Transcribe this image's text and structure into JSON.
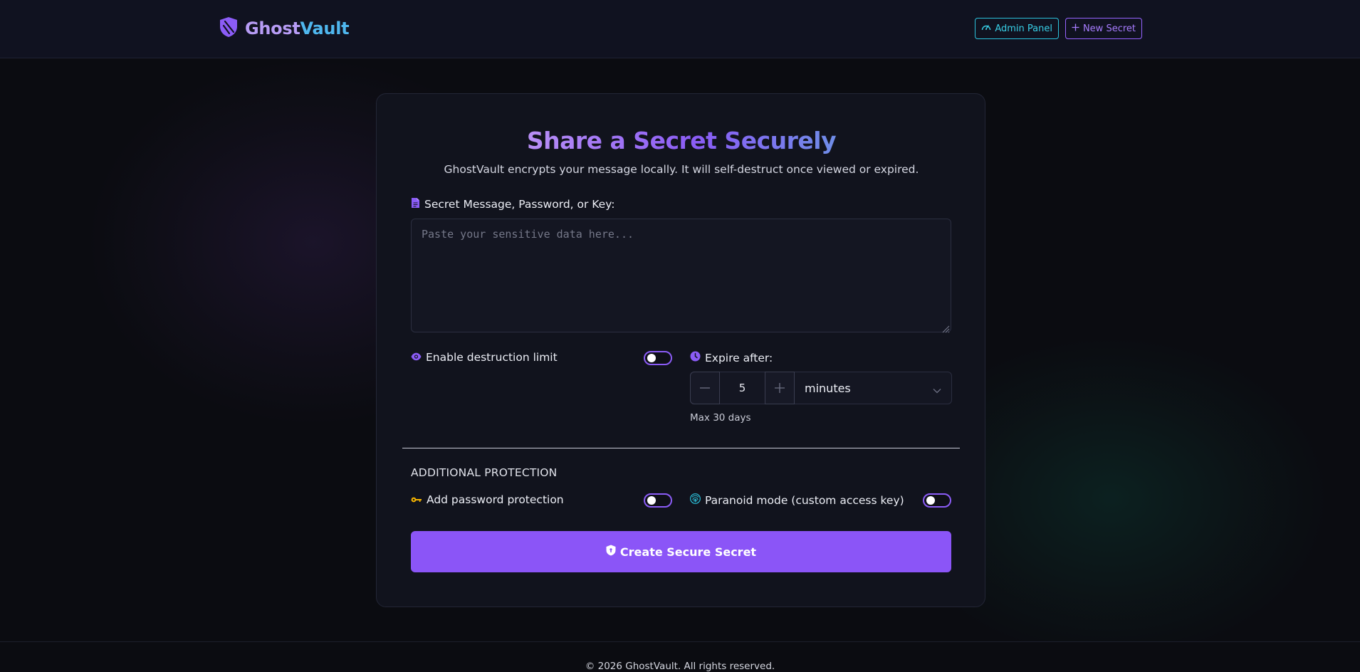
{
  "header": {
    "brand_part1": "Ghost",
    "brand_part2": "Vault",
    "admin_label": "Admin Panel",
    "new_label": "New Secret"
  },
  "card": {
    "title": "Share a Secret Securely",
    "subtitle": "GhostVault encrypts your message locally. It will self-destruct once viewed or expired.",
    "message_label": "Secret Message, Password, or Key:",
    "message_placeholder": "Paste your sensitive data here...",
    "destruction_label": "Enable destruction limit",
    "destruction_enabled": false,
    "expire_label": "Expire after:",
    "expire_value": "5",
    "expire_unit": "minutes",
    "expire_hint": "Max 30 days",
    "section_title": "ADDITIONAL PROTECTION",
    "password_label": "Add password protection",
    "password_enabled": false,
    "paranoid_label": "Paranoid mode (custom access key)",
    "paranoid_enabled": false,
    "cta_label": "Create Secure Secret"
  },
  "footer": {
    "text": "© 2026 GhostVault. All rights reserved."
  },
  "icons": {
    "brand": "shield-icon",
    "admin": "gauge-icon",
    "new": "plus-icon",
    "message": "file-icon",
    "destruction": "eye-icon",
    "expire": "clock-icon",
    "password": "key-icon",
    "paranoid": "fingerprint-icon",
    "cta": "shield-icon"
  },
  "colors": {
    "accent": "#8b55f7",
    "cyan": "#2cc2dc",
    "key": "#f5b400",
    "background": "#0b0c11",
    "card": "#11131d"
  }
}
